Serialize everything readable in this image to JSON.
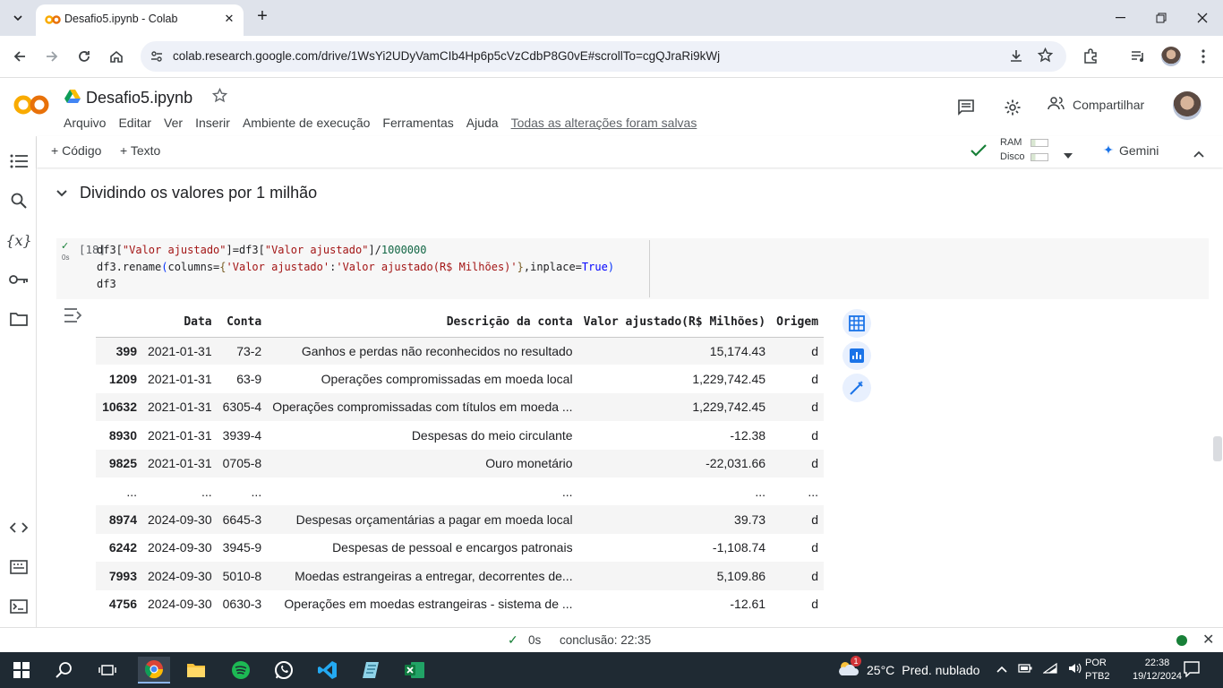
{
  "browser": {
    "tab_title": "Desafio5.ipynb - Colab",
    "url": "colab.research.google.com/drive/1WsYi2UDyVamCIb4Hp6p5cVzCdbP8G0vE#scrollTo=cgQJraRi9kWj"
  },
  "colab": {
    "notebook_title": "Desafio5.ipynb",
    "menu": [
      "Arquivo",
      "Editar",
      "Ver",
      "Inserir",
      "Ambiente de execução",
      "Ferramentas",
      "Ajuda"
    ],
    "saved_status": "Todas as alterações foram salvas",
    "share_label": "Compartilhar",
    "add_code": "Código",
    "add_text": "Texto",
    "ram_label": "RAM",
    "disk_label": "Disco",
    "gemini_label": "Gemini"
  },
  "section": {
    "title": "Dividindo os valores por 1 milhão"
  },
  "cell": {
    "exec_count": "[18]",
    "run_time": "0s",
    "code_lines": [
      "df3[\"Valor ajustado\"]=df3[\"Valor ajustado\"]/1000000",
      "df3.rename(columns={'Valor ajustado':'Valor ajustado(R$ Milhões)'},inplace=True)",
      "df3"
    ]
  },
  "dataframe": {
    "columns": [
      "",
      "Data",
      "Conta",
      "Descrição da conta",
      "Valor ajustado(R$ Milhões)",
      "Origem"
    ],
    "rows": [
      [
        "399",
        "2021-01-31",
        "73-2",
        "Ganhos e perdas não reconhecidos no resultado",
        "15,174.43",
        "d"
      ],
      [
        "1209",
        "2021-01-31",
        "63-9",
        "Operações compromissadas em moeda local",
        "1,229,742.45",
        "d"
      ],
      [
        "10632",
        "2021-01-31",
        "6305-4",
        "Operações compromissadas com títulos em moeda ...",
        "1,229,742.45",
        "d"
      ],
      [
        "8930",
        "2021-01-31",
        "3939-4",
        "Despesas do meio circulante",
        "-12.38",
        "d"
      ],
      [
        "9825",
        "2021-01-31",
        "0705-8",
        "Ouro monetário",
        "-22,031.66",
        "d"
      ],
      [
        "...",
        "...",
        "...",
        "...",
        "...",
        "..."
      ],
      [
        "8974",
        "2024-09-30",
        "6645-3",
        "Despesas orçamentárias a pagar em moeda local",
        "39.73",
        "d"
      ],
      [
        "6242",
        "2024-09-30",
        "3945-9",
        "Despesas de pessoal e encargos patronais",
        "-1,108.74",
        "d"
      ],
      [
        "7993",
        "2024-09-30",
        "5010-8",
        "Moedas estrangeiras a entregar, decorrentes de...",
        "5,109.86",
        "d"
      ],
      [
        "4756",
        "2024-09-30",
        "0630-3",
        "Operações em moedas estrangeiras - sistema de ...",
        "-12.61",
        "d"
      ]
    ]
  },
  "statusbar": {
    "time": "0s",
    "completion": "conclusão: 22:35"
  },
  "taskbar": {
    "weather_temp": "25°C",
    "weather_desc": "Pred. nublado",
    "weather_badge": "1",
    "lang_1": "POR",
    "lang_2": "PTB2",
    "time": "22:38",
    "date": "19/12/2024"
  }
}
